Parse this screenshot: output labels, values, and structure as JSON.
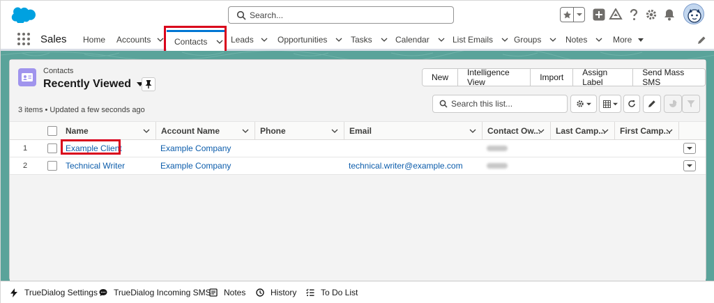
{
  "header": {
    "search_placeholder": "Search..."
  },
  "nav": {
    "app_name": "Sales",
    "items": [
      {
        "label": "Home"
      },
      {
        "label": "Accounts"
      },
      {
        "label": "Contacts"
      },
      {
        "label": "Leads"
      },
      {
        "label": "Opportunities"
      },
      {
        "label": "Tasks"
      },
      {
        "label": "Calendar"
      },
      {
        "label": "List Emails"
      },
      {
        "label": "Groups"
      },
      {
        "label": "Notes"
      },
      {
        "label": "More"
      }
    ],
    "active": "Contacts"
  },
  "list_view": {
    "object_label": "Contacts",
    "title": "Recently Viewed",
    "meta": "3 items • Updated a few seconds ago",
    "actions": [
      "New",
      "Intelligence View",
      "Import",
      "Assign Label",
      "Send Mass SMS"
    ],
    "search_placeholder": "Search this list...",
    "columns": [
      "Name",
      "Account Name",
      "Phone",
      "Email",
      "Contact Ow...",
      "Last Camp...",
      "First Camp..."
    ],
    "rows": [
      {
        "num": "1",
        "name": "Example Client",
        "account": "Example Company",
        "phone": "",
        "email": "",
        "owner": "davids"
      },
      {
        "num": "2",
        "name": "Technical Writer",
        "account": "Example Company",
        "phone": "",
        "email": "technical.writer@example.com",
        "owner": "davids"
      }
    ]
  },
  "utility_bar": {
    "items": [
      {
        "label": "TrueDialog Settings",
        "icon": "bolt-icon"
      },
      {
        "label": "TrueDialog Incoming SMS",
        "icon": "chat-icon"
      },
      {
        "label": "Notes",
        "icon": "notes-icon"
      },
      {
        "label": "History",
        "icon": "clock-icon"
      },
      {
        "label": "To Do List",
        "icon": "todo-list-icon"
      }
    ]
  },
  "colors": {
    "brand": "#0176d3",
    "highlight": "#d9001b",
    "background_teal": "#5aa39a",
    "contact_icon": "#a094ed"
  }
}
